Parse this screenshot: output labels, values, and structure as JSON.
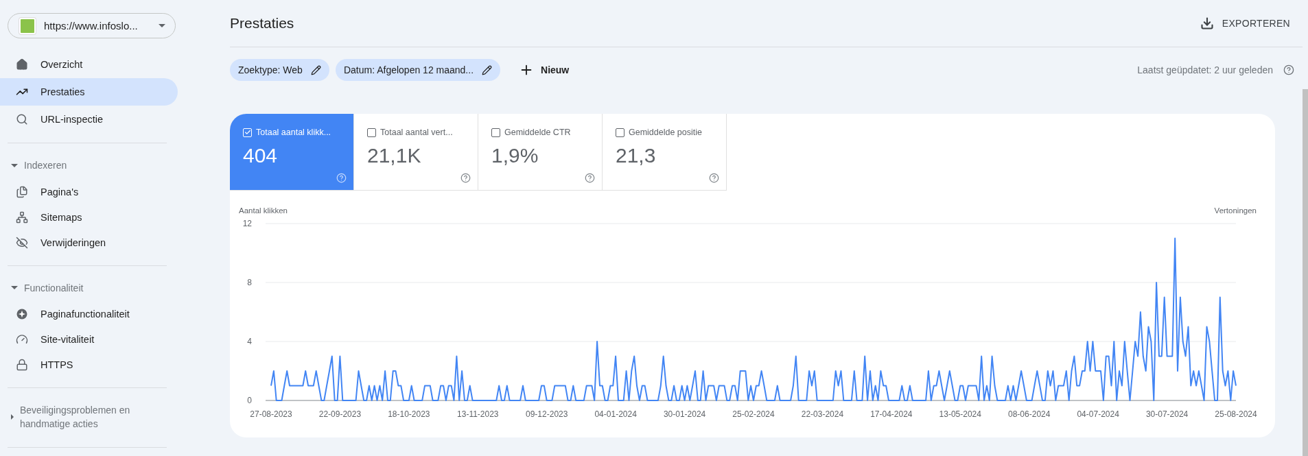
{
  "property_selector": {
    "value": "https://www.infoslo..."
  },
  "sidebar": {
    "items": [
      {
        "label": "Overzicht",
        "selected": false
      },
      {
        "label": "Prestaties",
        "selected": true
      },
      {
        "label": "URL-inspectie",
        "selected": false
      }
    ],
    "sections": [
      {
        "title": "Indexeren",
        "expanded": true,
        "items": [
          {
            "label": "Pagina's",
            "selected": false
          },
          {
            "label": "Sitemaps",
            "selected": false
          },
          {
            "label": "Verwijderingen",
            "selected": false
          }
        ]
      },
      {
        "title": "Functionaliteit",
        "expanded": true,
        "items": [
          {
            "label": "Paginafunctionaliteit",
            "selected": false
          },
          {
            "label": "Site-vitaliteit",
            "selected": false
          },
          {
            "label": "HTTPS",
            "selected": false
          }
        ]
      },
      {
        "title": "Beveiligingsproblemen en handmatige acties",
        "expanded": false
      }
    ]
  },
  "header": {
    "title": "Prestaties",
    "export_label": "EXPORTEREN"
  },
  "filters": [
    {
      "label": "Zoektype: Web"
    },
    {
      "label": "Datum: Afgelopen 12 maand..."
    }
  ],
  "new_filter_label": "Nieuw",
  "last_updated": "Laatst geüpdatet: 2 uur geleden",
  "metrics": [
    {
      "label": "Totaal aantal klikk...",
      "value": "404",
      "selected": true
    },
    {
      "label": "Totaal aantal vert...",
      "value": "21,1K",
      "selected": false
    },
    {
      "label": "Gemiddelde CTR",
      "value": "1,9%",
      "selected": false
    },
    {
      "label": "Gemiddelde positie",
      "value": "21,3",
      "selected": false
    }
  ],
  "chart": {
    "right_axis_label": "Vertoningen",
    "chart_data": {
      "type": "line",
      "ylabel": "Aantal klikken",
      "ylim": [
        0,
        12
      ],
      "yticks": [
        0,
        4,
        8,
        12
      ],
      "categories": [
        "27-08-2023",
        null,
        null,
        null,
        null,
        null,
        null,
        null,
        null,
        null,
        null,
        null,
        null,
        null,
        null,
        null,
        null,
        null,
        null,
        null,
        null,
        null,
        null,
        null,
        null,
        null,
        "22-09-2023",
        null,
        null,
        null,
        null,
        null,
        null,
        null,
        null,
        null,
        null,
        null,
        null,
        null,
        null,
        null,
        null,
        null,
        null,
        null,
        null,
        null,
        null,
        null,
        null,
        null,
        "18-10-2023",
        null,
        null,
        null,
        null,
        null,
        null,
        null,
        null,
        null,
        null,
        null,
        null,
        null,
        null,
        null,
        null,
        null,
        null,
        null,
        null,
        null,
        null,
        null,
        null,
        null,
        "13-11-2023",
        null,
        null,
        null,
        null,
        null,
        null,
        null,
        null,
        null,
        null,
        null,
        null,
        null,
        null,
        null,
        null,
        null,
        null,
        null,
        null,
        null,
        null,
        null,
        null,
        null,
        "09-12-2023",
        null,
        null,
        null,
        null,
        null,
        null,
        null,
        null,
        null,
        null,
        null,
        null,
        null,
        null,
        null,
        null,
        null,
        null,
        null,
        null,
        null,
        null,
        null,
        null,
        null,
        "04-01-2024",
        null,
        null,
        null,
        null,
        null,
        null,
        null,
        null,
        null,
        null,
        null,
        null,
        null,
        null,
        null,
        null,
        null,
        null,
        null,
        null,
        null,
        null,
        null,
        null,
        null,
        "30-01-2024",
        null,
        null,
        null,
        null,
        null,
        null,
        null,
        null,
        null,
        null,
        null,
        null,
        null,
        null,
        null,
        null,
        null,
        null,
        null,
        null,
        null,
        null,
        null,
        null,
        null,
        "25-02-2024",
        null,
        null,
        null,
        null,
        null,
        null,
        null,
        null,
        null,
        null,
        null,
        null,
        null,
        null,
        null,
        null,
        null,
        null,
        null,
        null,
        null,
        null,
        null,
        null,
        null,
        "22-03-2024",
        null,
        null,
        null,
        null,
        null,
        null,
        null,
        null,
        null,
        null,
        null,
        null,
        null,
        null,
        null,
        null,
        null,
        null,
        null,
        null,
        null,
        null,
        null,
        null,
        null,
        "17-04-2024",
        null,
        null,
        null,
        null,
        null,
        null,
        null,
        null,
        null,
        null,
        null,
        null,
        null,
        null,
        null,
        null,
        null,
        null,
        null,
        null,
        null,
        null,
        null,
        null,
        null,
        "13-05-2024",
        null,
        null,
        null,
        null,
        null,
        null,
        null,
        null,
        null,
        null,
        null,
        null,
        null,
        null,
        null,
        null,
        null,
        null,
        null,
        null,
        null,
        null,
        null,
        null,
        null,
        "08-06-2024",
        null,
        null,
        null,
        null,
        null,
        null,
        null,
        null,
        null,
        null,
        null,
        null,
        null,
        null,
        null,
        null,
        null,
        null,
        null,
        null,
        null,
        null,
        null,
        null,
        null,
        "04-07-2024",
        null,
        null,
        null,
        null,
        null,
        null,
        null,
        null,
        null,
        null,
        null,
        null,
        null,
        null,
        null,
        null,
        null,
        null,
        null,
        null,
        null,
        null,
        null,
        null,
        null,
        "30-07-2024",
        null,
        null,
        null,
        null,
        null,
        null,
        null,
        null,
        null,
        null,
        null,
        null,
        null,
        null,
        null,
        null,
        null,
        null,
        null,
        null,
        null,
        null,
        null,
        null,
        null,
        "25-08-2024"
      ],
      "series": [
        {
          "color": "#4285f4",
          "values": [
            1,
            2,
            0,
            0,
            0,
            1,
            2,
            1,
            1,
            1,
            1,
            1,
            1,
            2,
            1,
            1,
            1,
            2,
            1,
            0,
            0,
            1,
            2,
            3,
            0,
            0,
            3,
            0,
            0,
            0,
            0,
            0,
            0,
            2,
            1,
            0,
            0,
            1,
            0,
            1,
            0,
            1,
            0,
            2,
            0,
            0,
            2,
            2,
            1,
            1,
            0,
            0,
            0,
            1,
            0,
            0,
            0,
            0,
            1,
            1,
            1,
            0,
            0,
            0,
            1,
            1,
            0,
            1,
            1,
            0,
            3,
            0,
            2,
            0,
            0,
            1,
            0,
            0,
            0,
            0,
            0,
            0,
            0,
            0,
            0,
            0,
            1,
            0,
            0,
            1,
            0,
            0,
            0,
            0,
            0,
            1,
            0,
            0,
            0,
            0,
            0,
            0,
            1,
            1,
            0,
            0,
            0,
            1,
            1,
            1,
            1,
            1,
            0,
            0,
            1,
            0,
            0,
            0,
            0,
            1,
            1,
            1,
            0,
            4,
            1,
            1,
            0,
            0,
            1,
            1,
            3,
            0,
            0,
            0,
            2,
            0,
            2,
            3,
            1,
            0,
            1,
            1,
            0,
            0,
            0,
            0,
            0,
            1,
            3,
            1,
            0,
            0,
            1,
            0,
            0,
            1,
            0,
            1,
            0,
            1,
            2,
            0,
            0,
            2,
            0,
            1,
            1,
            1,
            0,
            1,
            1,
            1,
            0,
            0,
            1,
            1,
            0,
            2,
            2,
            2,
            0,
            1,
            0,
            1,
            1,
            2,
            1,
            0,
            0,
            0,
            0,
            1,
            0,
            0,
            0,
            0,
            0,
            1,
            3,
            0,
            0,
            0,
            0,
            2,
            1,
            2,
            0,
            0,
            0,
            0,
            0,
            0,
            0,
            2,
            1,
            2,
            0,
            0,
            0,
            0,
            2,
            0,
            0,
            0,
            3,
            0,
            2,
            0,
            1,
            0,
            2,
            1,
            1,
            0,
            0,
            0,
            0,
            0,
            1,
            0,
            0,
            1,
            0,
            0,
            0,
            0,
            0,
            0,
            2,
            0,
            1,
            1,
            2,
            1,
            0,
            1,
            2,
            1,
            0,
            0,
            1,
            1,
            0,
            1,
            1,
            1,
            1,
            0,
            3,
            0,
            1,
            0,
            3,
            1,
            0,
            0,
            0,
            0,
            1,
            0,
            1,
            0,
            1,
            2,
            1,
            0,
            0,
            0,
            1,
            2,
            1,
            0,
            0,
            2,
            1,
            2,
            0,
            1,
            1,
            1,
            2,
            0,
            2,
            3,
            1,
            1,
            2,
            2,
            4,
            2,
            4,
            2,
            2,
            2,
            0,
            3,
            3,
            1,
            4,
            0,
            2,
            1,
            4,
            2,
            0,
            2,
            4,
            3,
            6,
            3,
            2,
            5,
            4,
            0,
            8,
            3,
            3,
            7,
            3,
            3,
            3,
            11,
            2,
            7,
            4,
            3,
            5,
            1,
            2,
            1,
            2,
            1,
            0,
            5,
            4,
            2,
            0,
            0,
            7,
            2,
            1,
            2,
            0,
            2,
            1
          ]
        }
      ]
    }
  }
}
